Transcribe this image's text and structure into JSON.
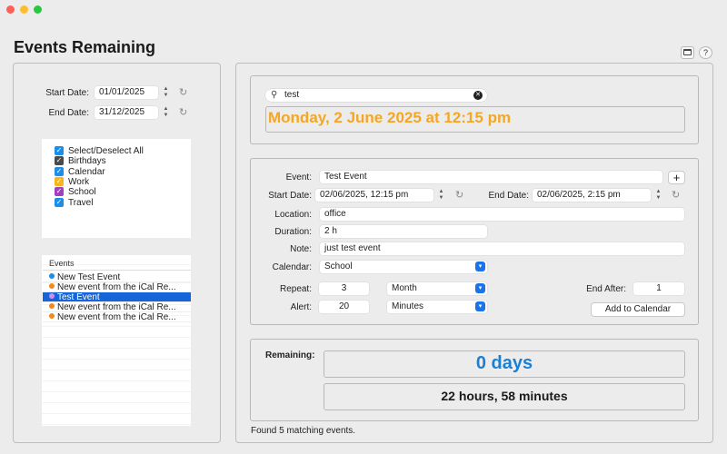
{
  "window": {
    "title": "Events Remaining"
  },
  "toolbar": {
    "help_label": "?"
  },
  "left": {
    "start_label": "Start Date:",
    "start_value": "01/01/2025",
    "end_label": "End Date:",
    "end_value": "31/12/2025",
    "calendars": [
      {
        "label": "Select/Deselect All",
        "color": "#1a8ee8"
      },
      {
        "label": "Birthdays",
        "color": "#4a4a4a"
      },
      {
        "label": "Calendar",
        "color": "#1a8ee8"
      },
      {
        "label": "Work",
        "color": "#f5b51f"
      },
      {
        "label": "School",
        "color": "#a040c0"
      },
      {
        "label": "Travel",
        "color": "#1a8ee8"
      }
    ],
    "events_header": "Events",
    "events": [
      {
        "label": "New Test Event",
        "color": "#1a8ee8",
        "selected": false
      },
      {
        "label": "New event from the iCal Re...",
        "color": "#f08a1c",
        "selected": false
      },
      {
        "label": "Test Event",
        "color": "#c070e0",
        "selected": true
      },
      {
        "label": "New event from the iCal Re...",
        "color": "#f08a1c",
        "selected": false
      },
      {
        "label": "New event from the iCal Re...",
        "color": "#f08a1c",
        "selected": false
      }
    ]
  },
  "search": {
    "value": "test",
    "date_display": "Monday, 2 June 2025 at 12:15 pm",
    "date_color": "#f5a623"
  },
  "form": {
    "event_label": "Event:",
    "event_value": "Test Event",
    "add_label": "+",
    "start_label": "Start Date:",
    "start_value": "02/06/2025, 12:15 pm",
    "end_label": "End Date:",
    "end_value": "02/06/2025,   2:15 pm",
    "location_label": "Location:",
    "location_value": "office",
    "duration_label": "Duration:",
    "duration_value": "2 h",
    "note_label": "Note:",
    "note_value": "just test event",
    "calendar_label": "Calendar:",
    "calendar_value": "School",
    "repeat_label": "Repeat:",
    "repeat_value": "3",
    "repeat_unit": "Month",
    "end_after_label": "End After:",
    "end_after_value": "1",
    "alert_label": "Alert:",
    "alert_value": "20",
    "alert_unit": "Minutes",
    "add_to_calendar": "Add to Calendar"
  },
  "remaining": {
    "label": "Remaining:",
    "days": "0 days",
    "days_color": "#1a7fd6",
    "time": "22 hours, 58 minutes"
  },
  "status": "Found 5 matching events."
}
